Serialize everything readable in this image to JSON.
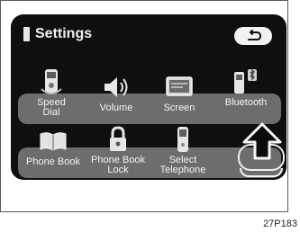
{
  "header": {
    "title": "Settings",
    "back_icon": "back-arrow-icon"
  },
  "menu": [
    {
      "label_line1": "Speed",
      "label_line2": "Dial",
      "icon": "speed-dial-icon"
    },
    {
      "label_line1": "Volume",
      "label_line2": "",
      "icon": "volume-icon"
    },
    {
      "label_line1": "Screen",
      "label_line2": "",
      "icon": "screen-icon"
    },
    {
      "label_line1": "Bluetooth",
      "label_line2": "",
      "icon": "bluetooth-phone-icon"
    },
    {
      "label_line1": "Phone Book",
      "label_line2": "",
      "icon": "phone-book-icon"
    },
    {
      "label_line1": "Phone Book",
      "label_line2": "Lock",
      "icon": "lock-icon"
    },
    {
      "label_line1": "Select",
      "label_line2": "Telephone",
      "icon": "telephone-icon"
    }
  ],
  "figure_code": "27P183"
}
